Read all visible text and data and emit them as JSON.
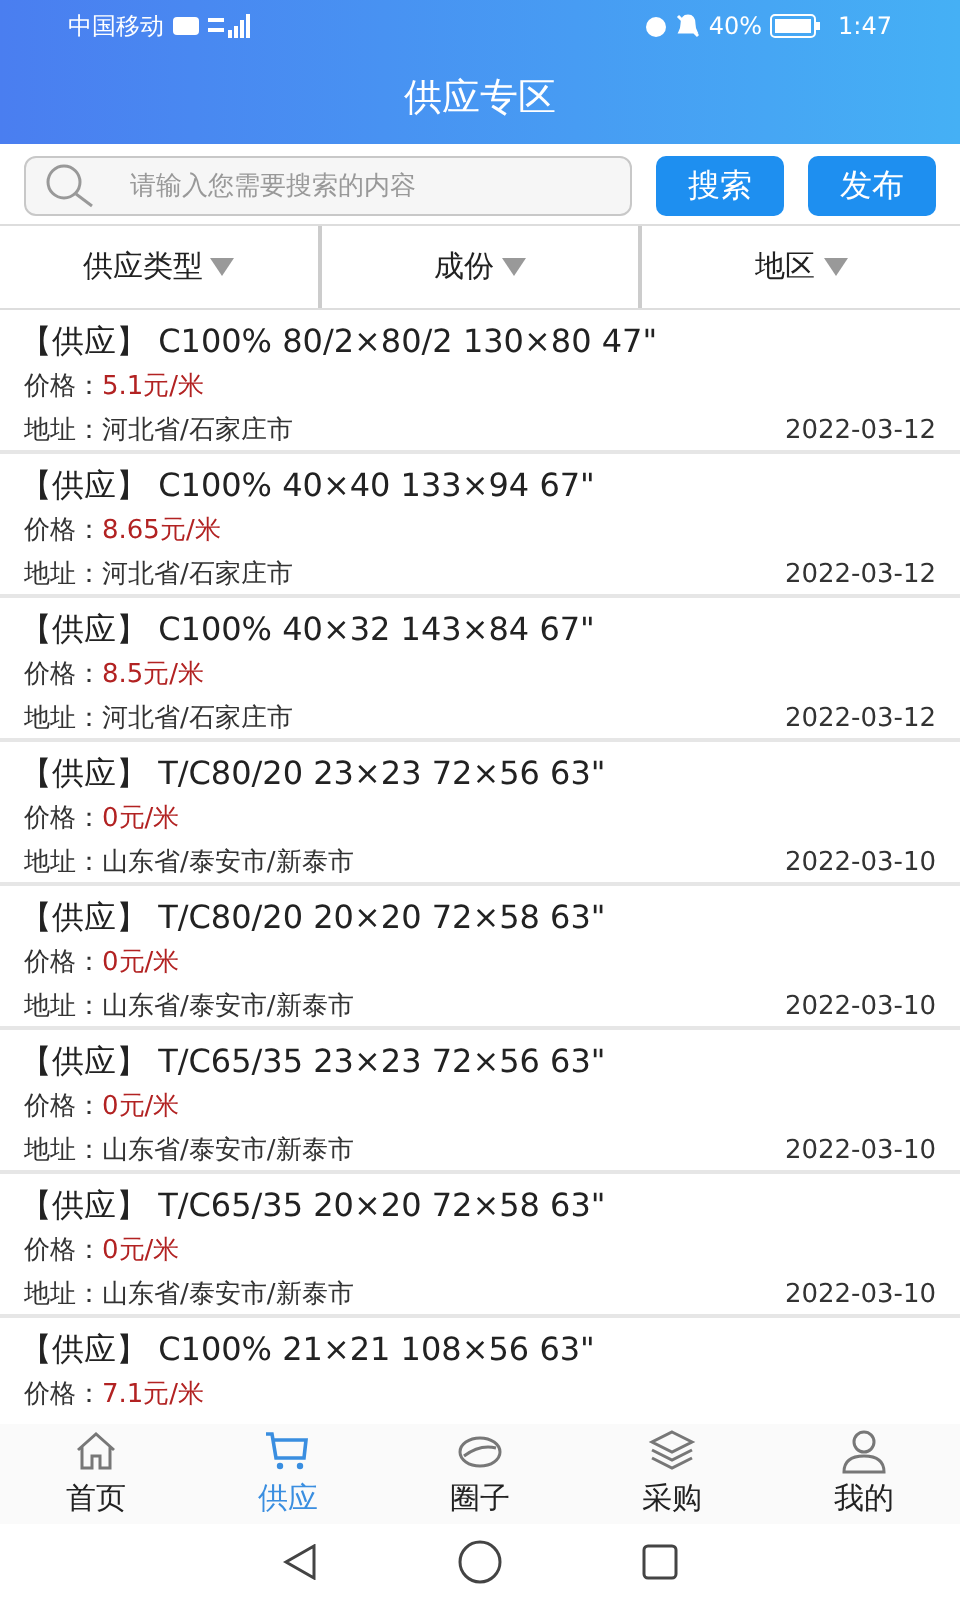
{
  "status_bar": {
    "carrier": "中国移动",
    "battery": "40%",
    "time": "1:47"
  },
  "header": {
    "title": "供应专区"
  },
  "search": {
    "placeholder": "请输入您需要搜索的内容",
    "buttons": [
      "搜索",
      "发布"
    ]
  },
  "filters": [
    {
      "label": "供应类型"
    },
    {
      "label": "成份"
    },
    {
      "label": "地区"
    }
  ],
  "listings": [
    {
      "tag": "【供应】",
      "title": "C100% 80/2×80/2 130×80 47\"",
      "price_label": "价格：",
      "price": "5.1元/米",
      "address_label": "地址：",
      "address": "河北省/石家庄市",
      "date": "2022-03-12"
    },
    {
      "tag": "【供应】",
      "title": "C100% 40×40 133×94 67\"",
      "price_label": "价格：",
      "price": "8.65元/米",
      "address_label": "地址：",
      "address": "河北省/石家庄市",
      "date": "2022-03-12"
    },
    {
      "tag": "【供应】",
      "title": "C100% 40×32 143×84 67\"",
      "price_label": "价格：",
      "price": "8.5元/米",
      "address_label": "地址：",
      "address": "河北省/石家庄市",
      "date": "2022-03-12"
    },
    {
      "tag": "【供应】",
      "title": "T/C80/20 23×23 72×56 63\"",
      "price_label": "价格：",
      "price": "0元/米",
      "address_label": "地址：",
      "address": "山东省/泰安市/新泰市",
      "date": "2022-03-10"
    },
    {
      "tag": "【供应】",
      "title": "T/C80/20 20×20 72×58 63\"",
      "price_label": "价格：",
      "price": "0元/米",
      "address_label": "地址：",
      "address": "山东省/泰安市/新泰市",
      "date": "2022-03-10"
    },
    {
      "tag": "【供应】",
      "title": "T/C65/35 23×23 72×56 63\"",
      "price_label": "价格：",
      "price": "0元/米",
      "address_label": "地址：",
      "address": "山东省/泰安市/新泰市",
      "date": "2022-03-10"
    },
    {
      "tag": "【供应】",
      "title": "T/C65/35 20×20 72×58 63\"",
      "price_label": "价格：",
      "price": "0元/米",
      "address_label": "地址：",
      "address": "山东省/泰安市/新泰市",
      "date": "2022-03-10"
    },
    {
      "tag": "【供应】",
      "title": "C100% 21×21 108×56 63\"",
      "price_label": "价格：",
      "price": "7.1元/米"
    }
  ],
  "tab_bar": [
    {
      "label": "首页",
      "kind": "home",
      "selected": false
    },
    {
      "label": "供应",
      "kind": "cart",
      "selected": true
    },
    {
      "label": "圈子",
      "kind": "circle",
      "selected": false
    },
    {
      "label": "采购",
      "kind": "layers",
      "selected": false
    },
    {
      "label": "我的",
      "kind": "user",
      "selected": false
    }
  ]
}
